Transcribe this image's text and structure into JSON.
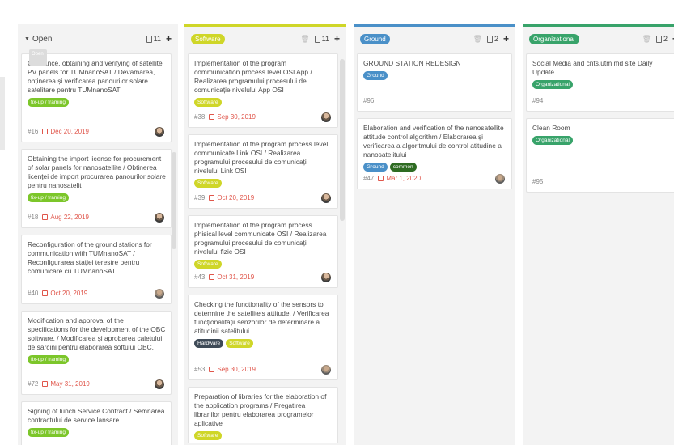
{
  "columns": {
    "open": {
      "title": "Open",
      "count": "11",
      "tooltip": "Open",
      "cards": [
        {
          "title": "Clearance, obtaining and verifying of satellite PV panels for TUMnanoSAT / Devamarea, obținerea și verificarea panourilor solare satelitare pentru TUMnanoSAT",
          "labels": [
            {
              "text": "fix-up / framing",
              "color": "#7cc62a"
            }
          ],
          "id": "#16",
          "date": "Dec 20, 2019"
        },
        {
          "title": "Obtaining the import license for procurement of solar panels for nanosatellite / Obtinerea licenței de import procurarea panourilor solare pentru nanosatelit",
          "labels": [
            {
              "text": "fix-up / framing",
              "color": "#7cc62a"
            }
          ],
          "id": "#18",
          "date": "Aug 22, 2019"
        },
        {
          "title": "Reconfiguration of the ground stations for communication with TUMnanoSAT / Reconfigurarea stației terestre pentru comunicare cu TUMnanoSAT",
          "labels": [],
          "id": "#40",
          "date": "Oct 20, 2019"
        },
        {
          "title": "Modification and approval of the specifications for the development of the OBC software. / Modificarea și aprobarea caietului de sarcini pentru elaborarea softului OBC.",
          "labels": [
            {
              "text": "fix-up / framing",
              "color": "#7cc62a"
            }
          ],
          "id": "#72",
          "date": "May 31, 2019"
        },
        {
          "title": "Signing of lunch Service Contract / Semnarea contractului de service lansare",
          "labels": [
            {
              "text": "fix-up / framing",
              "color": "#7cc62a"
            }
          ],
          "id": "",
          "date": ""
        }
      ]
    },
    "software": {
      "title": "Software",
      "color": "#cfd628",
      "count": "11",
      "cards": [
        {
          "title": "Implementation of the program communication process level OSI App / Realizarea programului procesului de comunicație nivelului App OSI",
          "labels": [
            {
              "text": "Software",
              "color": "#cfd628"
            }
          ],
          "id": "#38",
          "date": "Sep 30, 2019"
        },
        {
          "title": "Implementation of the program process level communicate Link OSI / Realizarea programului procesului de comunicați nivelului Link OSI",
          "labels": [
            {
              "text": "Software",
              "color": "#cfd628"
            }
          ],
          "id": "#39",
          "date": "Oct 20, 2019"
        },
        {
          "title": "Implementation of the program process phisical level communicate OSI / Realizarea programului procesului de comunicați nivelului fizic OSI",
          "labels": [
            {
              "text": "Software",
              "color": "#cfd628"
            }
          ],
          "id": "#43",
          "date": "Oct 31, 2019"
        },
        {
          "title": "Checking the functionality of the sensors to determine the satellite's attitude. / Verificarea funcționalității senzorilor de determinare a atitudinii satelitului.",
          "labels": [
            {
              "text": "Hardware",
              "color": "#3e4a57"
            },
            {
              "text": "Software",
              "color": "#cfd628"
            }
          ],
          "id": "#53",
          "date": "Sep 30, 2019"
        },
        {
          "title": "Preparation of libraries for the elaboration of the application programs / Pregatirea librariilor pentru elaborarea programelor aplicative",
          "labels": [
            {
              "text": "Software",
              "color": "#cfd628"
            }
          ],
          "id": "",
          "date": ""
        }
      ]
    },
    "ground": {
      "title": "Ground",
      "color": "#4a90c8",
      "count": "2",
      "cards": [
        {
          "title": "GROUND STATION REDESIGN",
          "labels": [
            {
              "text": "Ground",
              "color": "#4a90c8"
            }
          ],
          "id": "#96",
          "date": ""
        },
        {
          "title": "Elaboration and verification of the nanosatellite attitude control algorithm / Elaborarea și verificarea a algoritmului de control atitudine a nanosatelitului",
          "labels": [
            {
              "text": "Ground",
              "color": "#4a90c8"
            },
            {
              "text": "common",
              "color": "#2e6b22"
            }
          ],
          "id": "#47",
          "date": "Mar 1, 2020"
        }
      ]
    },
    "org": {
      "title": "Organizational",
      "color": "#38a36a",
      "count": "2",
      "cards": [
        {
          "title": "Social Media and cnts.utm.md site Daily Update",
          "labels": [
            {
              "text": "Organizational",
              "color": "#38a36a"
            }
          ],
          "id": "#94",
          "date": ""
        },
        {
          "title": "Clean Room",
          "labels": [
            {
              "text": "Organizational",
              "color": "#38a36a"
            }
          ],
          "id": "#95",
          "date": ""
        }
      ]
    }
  }
}
